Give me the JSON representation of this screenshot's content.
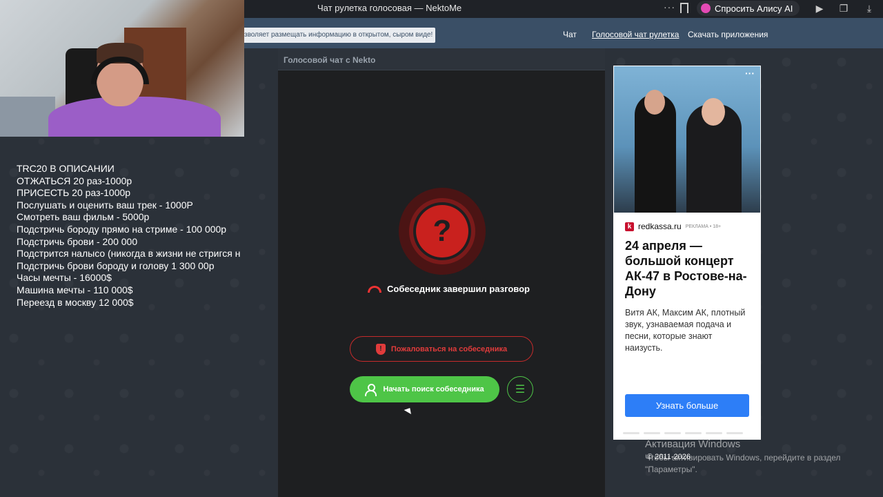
{
  "browser": {
    "tab_title": "Чат рулетка голосовая — NektoMe",
    "alice_label": "Спросить Алису AI"
  },
  "header": {
    "notice": "зволяет размещать информацию в открытом, сыром виде!",
    "nav": [
      "Чат",
      "Голосовой чат рулетка",
      "Скачать приложения"
    ]
  },
  "overlay_lines": [
    "TRC20 В ОПИСАНИИ",
    "ОТЖАТЬСЯ 20 раз-1000р",
    "ПРИСЕСТЬ 20 раз-1000р",
    "Послушать и оценить ваш трек - 1000Р",
    "Смотреть ваш фильм - 5000р",
    "Подстричь бороду прямо на стриме - 100 000р",
    "Подстричь брови - 200 000",
    "Подстрится налысо (никогда в жизни не стригся н",
    "Подстричь брови бороду и голову 1 300 00р",
    "Часы мечты - 16000$",
    "Машина мечты - 110 000$",
    "Переезд в москву 12 000$"
  ],
  "chat": {
    "header_title": "Голосовой чат с Nekto",
    "status_symbol": "?",
    "ended_text": "Собеседник завершил разговор",
    "report_label": "Пожаловаться на собеседника",
    "search_label": "Начать поиск собеседника"
  },
  "ad": {
    "source": "redkassa.ru",
    "tag": "РЕКЛАМА • 18+",
    "title": "24 апреля — большой концерт АК-47 в Ростове-на-Дону",
    "description": "Витя АК, Максим АК, плотный звук, узнаваемая подача и песни, которые знают наизусть.",
    "button": "Узнать больше"
  },
  "footer": {
    "copyright": "© 2011-2026",
    "windows_title": "Активация Windows",
    "windows_sub": "Чтобы активировать Windows, перейдите в раздел \"Параметры\"."
  },
  "colors": {
    "header_bg": "#3a4f66",
    "accent_green": "#4ec547",
    "accent_red": "#c9211e",
    "ad_button": "#2d7ef7"
  }
}
